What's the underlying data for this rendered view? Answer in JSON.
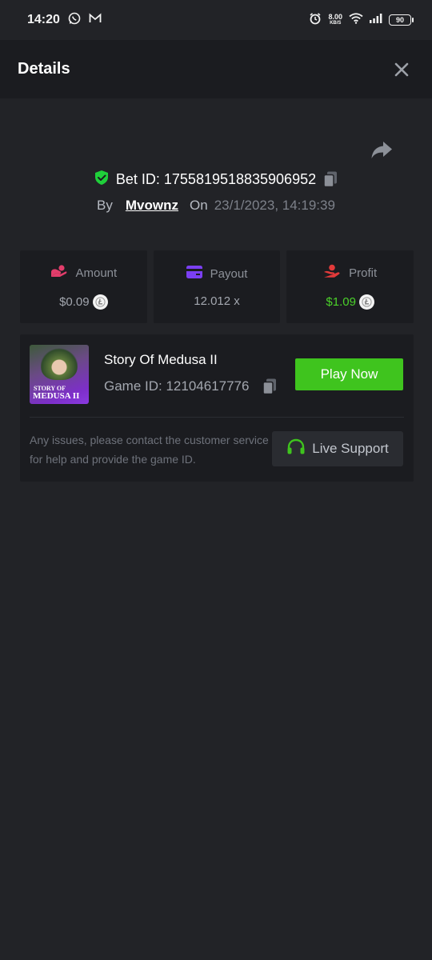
{
  "status_bar": {
    "time": "14:20",
    "net_speed": "8.00",
    "net_unit": "KB/S",
    "battery": "90"
  },
  "header": {
    "title": "Details"
  },
  "bet": {
    "label": "Bet ID: 1755819518835906952",
    "by_label": "By",
    "user": "Mvownz",
    "on_label": "On",
    "date": "23/1/2023, 14:19:39"
  },
  "stats": [
    {
      "label": "Amount",
      "value": "$0.09",
      "color": "#e23d6b"
    },
    {
      "label": "Payout",
      "value": "12.012 x",
      "color": "#7b3ff2"
    },
    {
      "label": "Profit",
      "value": "$1.09",
      "color": "#e23a3a"
    }
  ],
  "game": {
    "name": "Story Of Medusa II",
    "id_label": "Game ID: 12104617776",
    "thumb_line1": "STORY OF",
    "thumb_line2": "MEDUSA II",
    "play_label": "Play Now",
    "support_text": "Any issues, please contact the customer service for help and provide the game ID.",
    "support_label": "Live Support"
  },
  "colors": {
    "accent_green": "#3fc41e",
    "profit_green": "#4bd12a",
    "shield_green": "#1fcf3a"
  }
}
